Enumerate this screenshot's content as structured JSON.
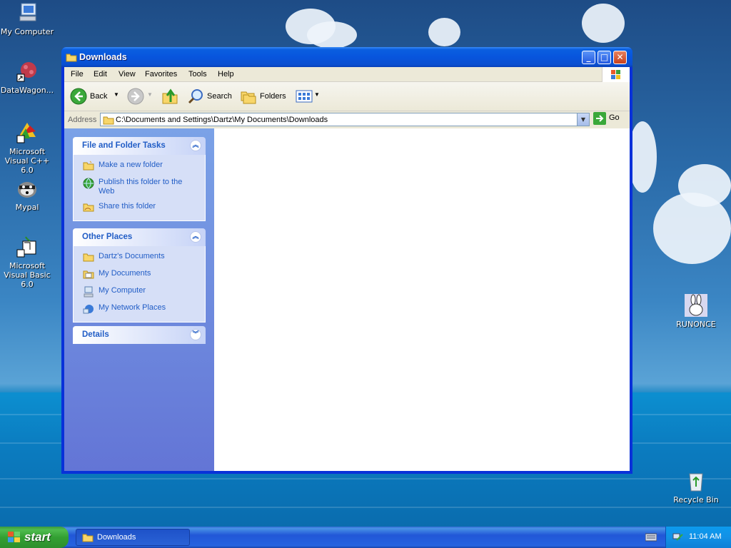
{
  "desktop": {
    "icons": [
      {
        "label": "My Computer",
        "icon": "my-computer-icon"
      },
      {
        "label": "DataWagon...",
        "icon": "datawagon-shortcut-icon"
      },
      {
        "label": "Microsoft Visual C++ 6.0",
        "icon": "visual-cpp-icon"
      },
      {
        "label": "Mypal",
        "icon": "mypal-raccoon-icon"
      },
      {
        "label": "Microsoft Visual Basic 6.0",
        "icon": "visual-basic-icon"
      },
      {
        "label": "RUNONCE",
        "icon": "runonce-rabbit-icon"
      },
      {
        "label": "Recycle Bin",
        "icon": "recycle-bin-icon"
      }
    ]
  },
  "window": {
    "title": "Downloads",
    "menu": [
      "File",
      "Edit",
      "View",
      "Favorites",
      "Tools",
      "Help"
    ],
    "toolbar": {
      "back": "Back",
      "search": "Search",
      "folders": "Folders"
    },
    "address": {
      "label": "Address",
      "value": "C:\\Documents and Settings\\Dartz\\My Documents\\Downloads",
      "go": "Go"
    },
    "panels": {
      "tasks": {
        "title": "File and Folder Tasks",
        "links": [
          "Make a new folder",
          "Publish this folder to the Web",
          "Share this folder"
        ]
      },
      "places": {
        "title": "Other Places",
        "links": [
          "Dartz's Documents",
          "My Documents",
          "My Computer",
          "My Network Places"
        ]
      },
      "details": {
        "title": "Details"
      }
    }
  },
  "taskbar": {
    "start": "start",
    "task": "Downloads",
    "clock": "11:04 AM"
  },
  "colors": {
    "title_blue": "#0855dd",
    "link_blue": "#215dc6",
    "start_green": "#3ca03c"
  }
}
